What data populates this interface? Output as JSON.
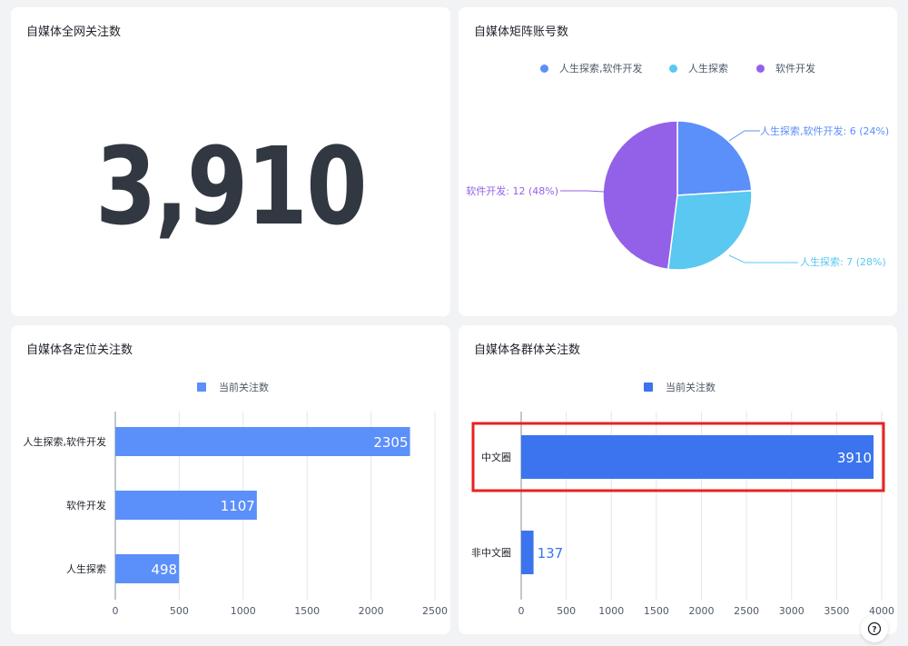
{
  "cards": {
    "total": {
      "title": "自媒体全网关注数",
      "value": "3,910"
    },
    "accounts": {
      "title": "自媒体矩阵账号数",
      "legend": [
        {
          "label": "人生探索,软件开发",
          "color": "#5b8ff9"
        },
        {
          "label": "人生探索",
          "color": "#5ac8f0"
        },
        {
          "label": "软件开发",
          "color": "#9361e8"
        }
      ],
      "labels": [
        "人生探索,软件开发: 6 (24%)",
        "人生探索: 7 (28%)",
        "软件开发: 12 (48%)"
      ]
    },
    "positioning": {
      "title": "自媒体各定位关注数",
      "legend": "当前关注数"
    },
    "groups": {
      "title": "自媒体各群体关注数",
      "legend": "当前关注数"
    }
  },
  "chart_data": [
    {
      "type": "pie",
      "categories": [
        "人生探索,软件开发",
        "人生探索",
        "软件开发"
      ],
      "values": [
        6,
        7,
        12
      ],
      "percents": [
        24,
        28,
        48
      ],
      "colors": [
        "#5b8ff9",
        "#5ac8f0",
        "#9361e8"
      ],
      "legend_position": "top"
    },
    {
      "type": "bar",
      "orientation": "horizontal",
      "categories": [
        "人生探索,软件开发",
        "软件开发",
        "人生探索"
      ],
      "series": [
        {
          "name": "当前关注数",
          "values": [
            2305,
            1107,
            498
          ]
        }
      ],
      "xlim": [
        0,
        2500
      ],
      "xticks": [
        0,
        500,
        1000,
        1500,
        2000,
        2500
      ],
      "color": "#5b8ff9",
      "grid": true,
      "legend_position": "top"
    },
    {
      "type": "bar",
      "orientation": "horizontal",
      "categories": [
        "中文圈",
        "非中文圈"
      ],
      "series": [
        {
          "name": "当前关注数",
          "values": [
            3910,
            137
          ]
        }
      ],
      "xlim": [
        0,
        4000
      ],
      "xticks": [
        0,
        500,
        1000,
        1500,
        2000,
        2500,
        3000,
        3500,
        4000
      ],
      "color": "#3b74ee",
      "grid": true,
      "highlight_category": "中文圈",
      "highlight_color": "#e8221e",
      "legend_position": "top"
    }
  ],
  "help": {
    "icon": "question-circle-icon",
    "label": "?"
  }
}
